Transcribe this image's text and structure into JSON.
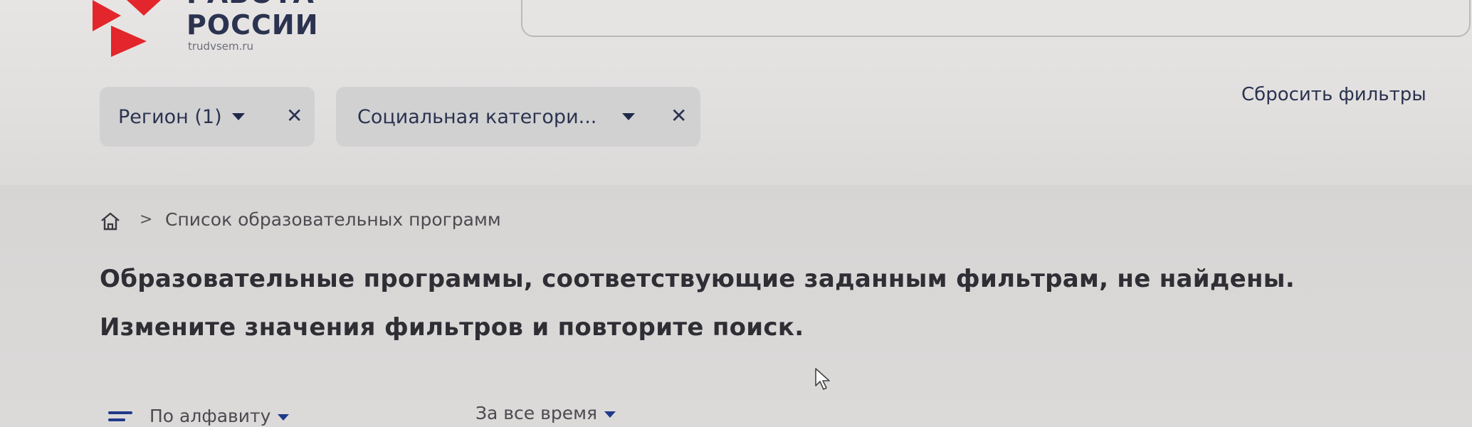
{
  "logo": {
    "title_line1": "РАБОТА",
    "title_line2": "РОССИИ",
    "site": "trudvsem.ru",
    "brand_color": "#e2262b"
  },
  "filters": {
    "chips": [
      {
        "label": "Регион (1)",
        "remove": "✕"
      },
      {
        "label": "Социальная категори...",
        "remove": "✕"
      }
    ],
    "reset_label": "Сбросить фильтры"
  },
  "breadcrumb": {
    "separator": ">",
    "current": "Список образовательных программ"
  },
  "message": {
    "line1": "Образовательные программы, соответствующие заданным фильтрам, не найдены.",
    "line2": "Измените значения фильтров и повторите поиск."
  },
  "sort": {
    "order_label": "По алфавиту",
    "period_label": "За все время"
  },
  "icons": {
    "home": "home-icon",
    "sort": "sort-lines-icon",
    "caret": "caret-down-icon",
    "close": "close-icon"
  }
}
